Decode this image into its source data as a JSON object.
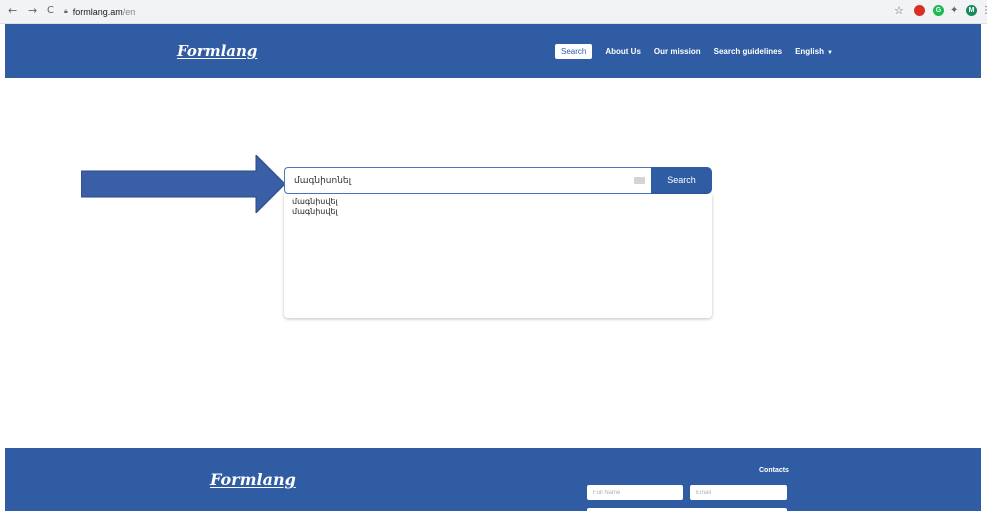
{
  "browser": {
    "url_host": "formlang.am",
    "url_path": "/en",
    "back": "←",
    "forward": "→",
    "reload": "C",
    "star": "☆",
    "profile_letter": "M",
    "menu": "⋮",
    "ext_letter": "G",
    "colors": {
      "ext1": "#d93025",
      "ext2": "#1db954",
      "profile": "#1a8a5c"
    }
  },
  "header": {
    "logo": "Formlang",
    "nav": [
      {
        "label": "Search",
        "active": true
      },
      {
        "label": "About Us"
      },
      {
        "label": "Our mission"
      },
      {
        "label": "Search guidelines"
      },
      {
        "label": "English"
      }
    ]
  },
  "search": {
    "value": "մագնիսոնել",
    "button": "Search",
    "suggestions": [
      "մագնիսվել",
      "մագնիսվել"
    ]
  },
  "footer": {
    "logo": "Formlang",
    "contacts": "Contacts",
    "full_name_placeholder": "Full Name",
    "email_placeholder": "Email"
  },
  "colors": {
    "primary": "#2f5ca3",
    "arrow": "#3b5fa6"
  }
}
